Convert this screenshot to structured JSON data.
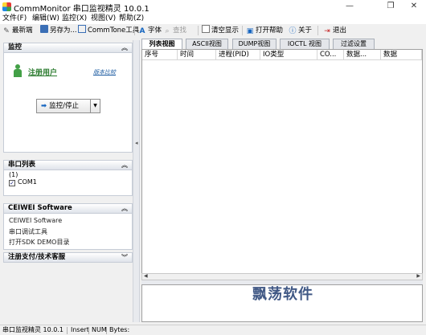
{
  "window": {
    "title": "CommMonitor 串口监视精灵 10.0.1",
    "minimize_glyph": "—",
    "maximize_glyph": "❐",
    "close_glyph": "✕"
  },
  "menu": [
    "文件(F)",
    "编辑(W)",
    "监控(X)",
    "视图(V)",
    "帮助(Z)"
  ],
  "toolbar": {
    "new_label": "最新端",
    "save_as_label": "另存为...",
    "commtone_label": "CommTone工具",
    "font_label": "字体",
    "find_label": "查找",
    "clear_label": "清空显示",
    "help_label": "打开帮助",
    "about_label": "关于",
    "exit_label": "退出"
  },
  "monitor_panel": {
    "title": "监控",
    "registered_user": "注册用户",
    "quote_link": "版本比较",
    "button_label": "监控/停止"
  },
  "port_panel": {
    "title": "串口列表",
    "count": "(1)",
    "ports": [
      {
        "name": "COM1",
        "checked": true
      }
    ]
  },
  "ceiwei_panel": {
    "title": "CEIWEI Software",
    "links": [
      "CEIWEI Software",
      "串口调试工具",
      "打开SDK DEMO目录"
    ]
  },
  "support_panel": {
    "title": "注册支付/技术客服"
  },
  "tabs": [
    {
      "label": "列表视图",
      "active": true
    },
    {
      "label": "ASCII视图",
      "active": false
    },
    {
      "label": "DUMP视图",
      "active": false
    },
    {
      "label": "IOCTL 视图",
      "active": false
    },
    {
      "label": "过滤设置",
      "active": false
    }
  ],
  "columns": [
    "序号",
    "时间",
    "进程(PID)",
    "IO类型",
    "CO...",
    "数据...",
    "数据"
  ],
  "watermark": "飘荡软件",
  "status": {
    "app": "串口监视精灵 10.0.1",
    "mode": "Insert",
    "num": "NUM",
    "bytes": "Bytes:"
  },
  "colors": {
    "accent_green": "#43a047",
    "link_blue": "#1a5aa0",
    "watermark": "#1f3c70"
  }
}
